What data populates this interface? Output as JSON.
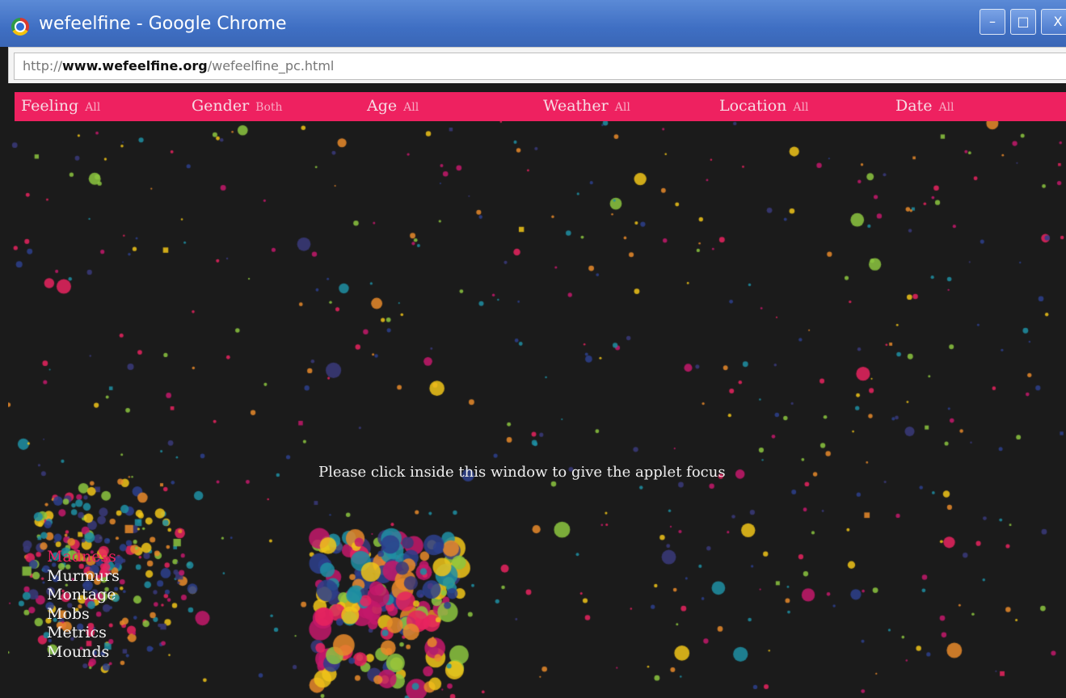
{
  "window": {
    "title": "wefeelfine - Google Chrome",
    "controls": {
      "minimize": "–",
      "maximize": "□",
      "close": "X"
    }
  },
  "address_bar": {
    "scheme": "http://",
    "host": "www.wefeelfine.org",
    "path": "/wefeelfine_pc.html"
  },
  "filters": [
    {
      "label": "Feeling",
      "value": "All"
    },
    {
      "label": "Gender",
      "value": "Both"
    },
    {
      "label": "Age",
      "value": "All"
    },
    {
      "label": "Weather",
      "value": "All"
    },
    {
      "label": "Location",
      "value": "All"
    },
    {
      "label": "Date",
      "value": "All"
    }
  ],
  "applet": {
    "focus_message": "Please click inside this window to give the applet focus"
  },
  "modes": [
    "Madness",
    "Murmurs",
    "Montage",
    "Mobs",
    "Metrics",
    "Mounds"
  ],
  "active_mode": "Madness",
  "colors": {
    "accent": "#ee2160",
    "background": "#1b1b1b",
    "particles": [
      "#e8235f",
      "#f0c419",
      "#e8892a",
      "#1f8fa3",
      "#2d3f8c",
      "#8cc63f",
      "#c3196b",
      "#3a3a7a"
    ]
  }
}
